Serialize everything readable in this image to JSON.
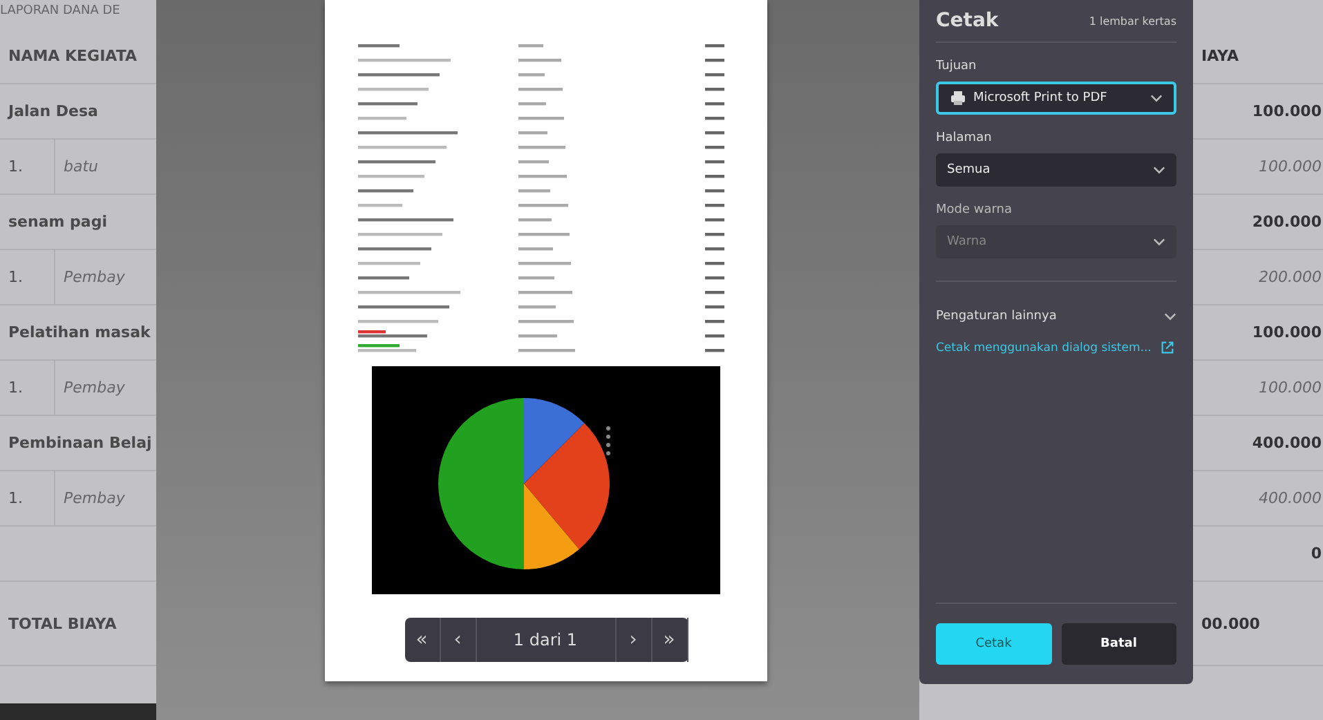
{
  "report_title": "LAPORAN DANA DE",
  "table": {
    "columns": [
      "NAMA KEGIATA",
      "IAYA"
    ],
    "rows": [
      {
        "kind": "group",
        "name": "Jalan Desa",
        "amount": "100.000"
      },
      {
        "kind": "item",
        "number": "1.",
        "name": "batu",
        "amount": "100.000"
      },
      {
        "kind": "group",
        "name": "senam pagi",
        "amount": "200.000"
      },
      {
        "kind": "item",
        "number": "1.",
        "name": "Pembay",
        "amount": "200.000"
      },
      {
        "kind": "group",
        "name": "Pelatihan masak",
        "amount": "100.000"
      },
      {
        "kind": "item",
        "number": "1.",
        "name": "Pembay",
        "amount": "100.000"
      },
      {
        "kind": "group",
        "name": "Pembinaan Belaj",
        "amount": "400.000"
      },
      {
        "kind": "item",
        "number": "1.",
        "name": "Pembay",
        "amount": "400.000"
      },
      {
        "kind": "blank",
        "amount": "0"
      }
    ],
    "total": {
      "label": "TOTAL BIAYA",
      "amount": "00.000"
    }
  },
  "preview": {
    "pager": {
      "first": "«",
      "prev": "‹",
      "page": "1 dari 1",
      "next": "›",
      "last": "»"
    }
  },
  "print_dialog": {
    "title": "Cetak",
    "sheets": "1 lembar kertas",
    "fields": [
      {
        "label": "Tujuan",
        "value": "Microsoft Print to PDF",
        "focused": true,
        "disabled": false,
        "kind": "printer"
      },
      {
        "label": "Halaman",
        "value": "Semua",
        "focused": false,
        "disabled": false,
        "kind": "plain"
      },
      {
        "label": "Mode warna",
        "value": "Warna",
        "focused": false,
        "disabled": true,
        "kind": "plain"
      }
    ],
    "more_settings": {
      "label": "Pengaturan lainnya",
      "expanded": false
    },
    "system_dialog_link": "Cetak menggunakan dialog sistem...",
    "buttons": [
      {
        "label": "Cetak",
        "primary": true
      },
      {
        "label": "Batal",
        "primary": false
      }
    ]
  }
}
